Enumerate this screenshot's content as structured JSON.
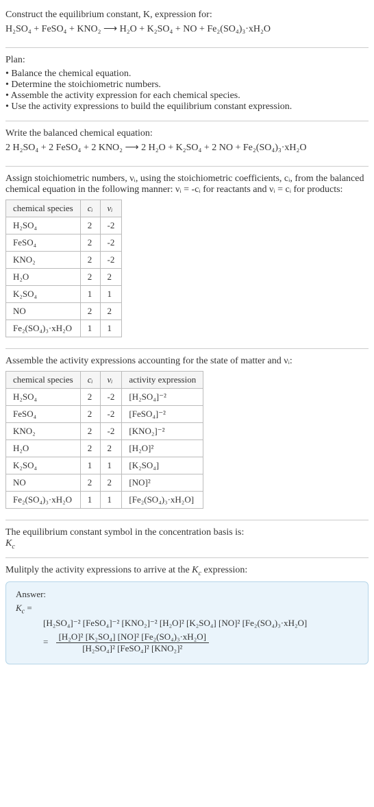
{
  "intro": {
    "prompt": "Construct the equilibrium constant, K, expression for:",
    "equation": "H₂SO₄ + FeSO₄ + KNO₂ ⟶ H₂O + K₂SO₄ + NO + Fe₂(SO₄)₃·xH₂O"
  },
  "plan": {
    "label": "Plan:",
    "items": [
      "Balance the chemical equation.",
      "Determine the stoichiometric numbers.",
      "Assemble the activity expression for each chemical species.",
      "Use the activity expressions to build the equilibrium constant expression."
    ]
  },
  "balanced": {
    "label": "Write the balanced chemical equation:",
    "equation": "2 H₂SO₄ + 2 FeSO₄ + 2 KNO₂ ⟶ 2 H₂O + K₂SO₄ + 2 NO + Fe₂(SO₄)₃·xH₂O"
  },
  "stoich_intro": "Assign stoichiometric numbers, νᵢ, using the stoichiometric coefficients, cᵢ, from the balanced chemical equation in the following manner: νᵢ = -cᵢ for reactants and νᵢ = cᵢ for products:",
  "stoich_table": {
    "headers": [
      "chemical species",
      "cᵢ",
      "νᵢ"
    ],
    "rows": [
      [
        "H₂SO₄",
        "2",
        "-2"
      ],
      [
        "FeSO₄",
        "2",
        "-2"
      ],
      [
        "KNO₂",
        "2",
        "-2"
      ],
      [
        "H₂O",
        "2",
        "2"
      ],
      [
        "K₂SO₄",
        "1",
        "1"
      ],
      [
        "NO",
        "2",
        "2"
      ],
      [
        "Fe₂(SO₄)₃·xH₂O",
        "1",
        "1"
      ]
    ]
  },
  "activity_intro": "Assemble the activity expressions accounting for the state of matter and νᵢ:",
  "activity_table": {
    "headers": [
      "chemical species",
      "cᵢ",
      "νᵢ",
      "activity expression"
    ],
    "rows": [
      [
        "H₂SO₄",
        "2",
        "-2",
        "[H₂SO₄]⁻²"
      ],
      [
        "FeSO₄",
        "2",
        "-2",
        "[FeSO₄]⁻²"
      ],
      [
        "KNO₂",
        "2",
        "-2",
        "[KNO₂]⁻²"
      ],
      [
        "H₂O",
        "2",
        "2",
        "[H₂O]²"
      ],
      [
        "K₂SO₄",
        "1",
        "1",
        "[K₂SO₄]"
      ],
      [
        "NO",
        "2",
        "2",
        "[NO]²"
      ],
      [
        "Fe₂(SO₄)₃·xH₂O",
        "1",
        "1",
        "[Fe₂(SO₄)₃·xH₂O]"
      ]
    ]
  },
  "kc_basis": {
    "line1": "The equilibrium constant symbol in the concentration basis is:",
    "line2": "K_c"
  },
  "multiply_intro": "Mulitply the activity expressions to arrive at the K_c expression:",
  "answer": {
    "label": "Answer:",
    "kc_eq": "K_c =",
    "long": "[H₂SO₄]⁻² [FeSO₄]⁻² [KNO₂]⁻² [H₂O]² [K₂SO₄] [NO]² [Fe₂(SO₄)₃·xH₂O]",
    "frac_num": "[H₂O]² [K₂SO₄] [NO]² [Fe₂(SO₄)₃·xH₂O]",
    "frac_den": "[H₂SO₄]² [FeSO₄]² [KNO₂]²"
  },
  "chart_data": {
    "type": "table",
    "tables": [
      {
        "title": "Stoichiometric numbers",
        "headers": [
          "chemical species",
          "c_i",
          "ν_i"
        ],
        "rows": [
          {
            "species": "H2SO4",
            "c": 2,
            "nu": -2
          },
          {
            "species": "FeSO4",
            "c": 2,
            "nu": -2
          },
          {
            "species": "KNO2",
            "c": 2,
            "nu": -2
          },
          {
            "species": "H2O",
            "c": 2,
            "nu": 2
          },
          {
            "species": "K2SO4",
            "c": 1,
            "nu": 1
          },
          {
            "species": "NO",
            "c": 2,
            "nu": 2
          },
          {
            "species": "Fe2(SO4)3·xH2O",
            "c": 1,
            "nu": 1
          }
        ]
      },
      {
        "title": "Activity expressions",
        "headers": [
          "chemical species",
          "c_i",
          "ν_i",
          "activity expression"
        ],
        "rows": [
          {
            "species": "H2SO4",
            "c": 2,
            "nu": -2,
            "activity": "[H2SO4]^-2"
          },
          {
            "species": "FeSO4",
            "c": 2,
            "nu": -2,
            "activity": "[FeSO4]^-2"
          },
          {
            "species": "KNO2",
            "c": 2,
            "nu": -2,
            "activity": "[KNO2]^-2"
          },
          {
            "species": "H2O",
            "c": 2,
            "nu": 2,
            "activity": "[H2O]^2"
          },
          {
            "species": "K2SO4",
            "c": 1,
            "nu": 1,
            "activity": "[K2SO4]"
          },
          {
            "species": "NO",
            "c": 2,
            "nu": 2,
            "activity": "[NO]^2"
          },
          {
            "species": "Fe2(SO4)3·xH2O",
            "c": 1,
            "nu": 1,
            "activity": "[Fe2(SO4)3·xH2O]"
          }
        ]
      }
    ]
  }
}
